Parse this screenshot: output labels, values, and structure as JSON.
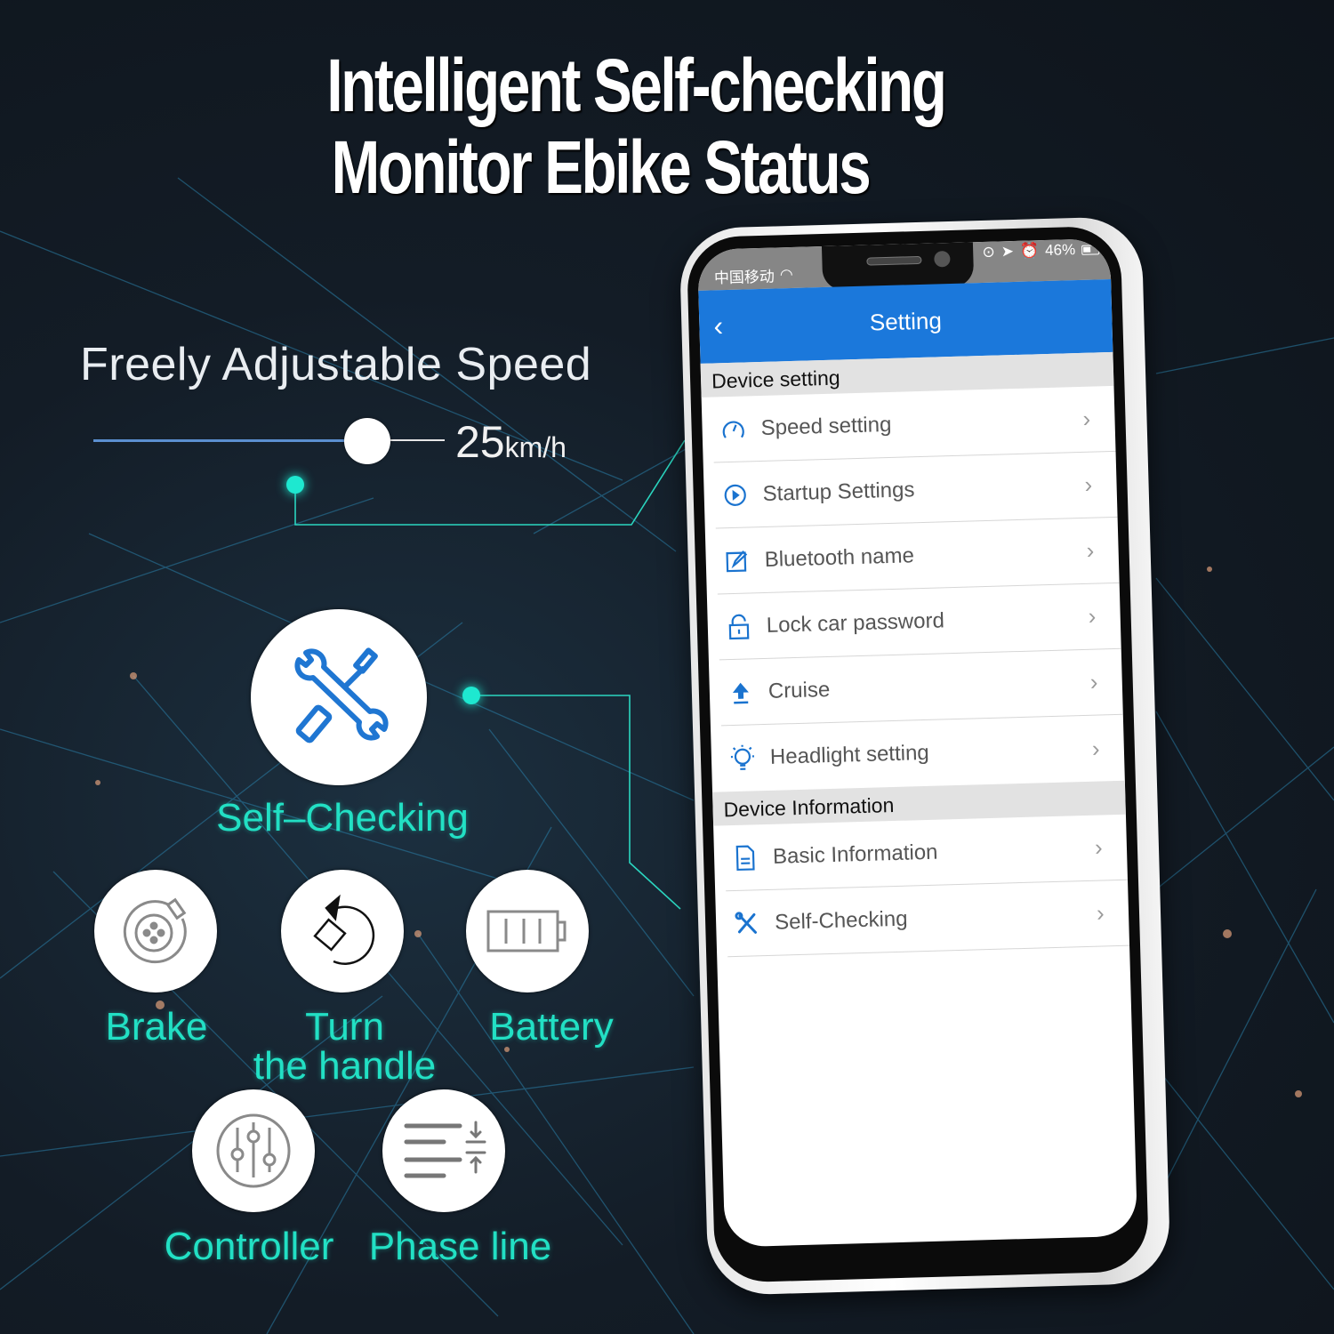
{
  "headline": {
    "line1": "Intelligent Self-checking",
    "line2": "Monitor Ebike Status"
  },
  "speed_feature": {
    "title": "Freely Adjustable Speed",
    "value": "25",
    "unit": "km/h",
    "slider_fraction": 0.78
  },
  "self_check": {
    "label": "Self–Checking",
    "icon": "wrench-screwdriver-icon"
  },
  "check_items": [
    {
      "label": "Brake",
      "icon": "brake-disc-icon"
    },
    {
      "label_line1": "Turn",
      "label_line2": "the handle",
      "icon": "rotate-handle-icon"
    },
    {
      "label": "Battery",
      "icon": "battery-icon"
    },
    {
      "label": "Controller",
      "icon": "controller-sliders-icon"
    },
    {
      "label": "Phase line",
      "icon": "phase-line-icon"
    }
  ],
  "phone": {
    "statusbar": {
      "carrier": "中国移动",
      "battery": "46%"
    },
    "navbar": {
      "back": "‹",
      "title": "Setting"
    },
    "sections": [
      {
        "header": "Device setting",
        "rows": [
          {
            "label": "Speed setting",
            "icon": "speedometer-icon"
          },
          {
            "label": "Startup Settings",
            "icon": "play-circle-icon"
          },
          {
            "label": "Bluetooth name",
            "icon": "edit-icon"
          },
          {
            "label": "Lock car password",
            "icon": "unlock-icon"
          },
          {
            "label": "Cruise",
            "icon": "upload-arrow-icon"
          },
          {
            "label": "Headlight setting",
            "icon": "lightbulb-icon"
          }
        ]
      },
      {
        "header": "Device Information",
        "rows": [
          {
            "label": "Basic Information",
            "icon": "document-icon"
          },
          {
            "label": "Self-Checking",
            "icon": "tools-icon"
          }
        ]
      }
    ],
    "chevron": "›"
  },
  "colors": {
    "accent_blue": "#1b78db",
    "teal": "#22e0c4",
    "icon_blue": "#1a73cf"
  }
}
